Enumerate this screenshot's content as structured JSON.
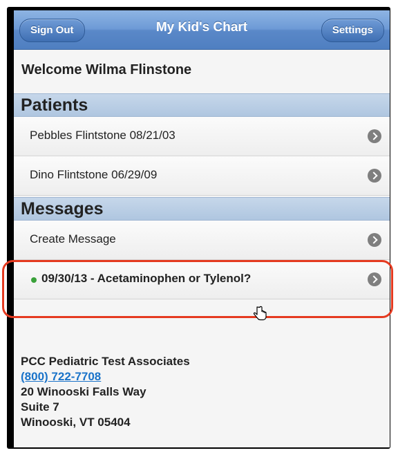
{
  "header": {
    "title": "My Kid's Chart",
    "sign_out_label": "Sign Out",
    "settings_label": "Settings"
  },
  "welcome": "Welcome Wilma Flinstone",
  "patients": {
    "heading": "Patients",
    "items": [
      {
        "label": "Pebbles Flintstone 08/21/03"
      },
      {
        "label": "Dino Flintstone 06/29/09"
      }
    ]
  },
  "messages": {
    "heading": "Messages",
    "create_label": "Create Message",
    "items": [
      {
        "label": "09/30/13 - Acetaminophen or Tylenol?",
        "unread": true
      }
    ]
  },
  "practice": {
    "name": "PCC Pediatric Test Associates",
    "phone": "(800) 722-7708",
    "address1": "20 Winooski Falls Way",
    "address2": "Suite 7",
    "city_state_zip": "Winooski, VT 05404"
  },
  "colors": {
    "header_blue": "#5a88c8",
    "section_blue": "#b9cde4",
    "unread_dot": "#3aa13a",
    "highlight": "#e53a20",
    "link": "#1a73c9"
  }
}
